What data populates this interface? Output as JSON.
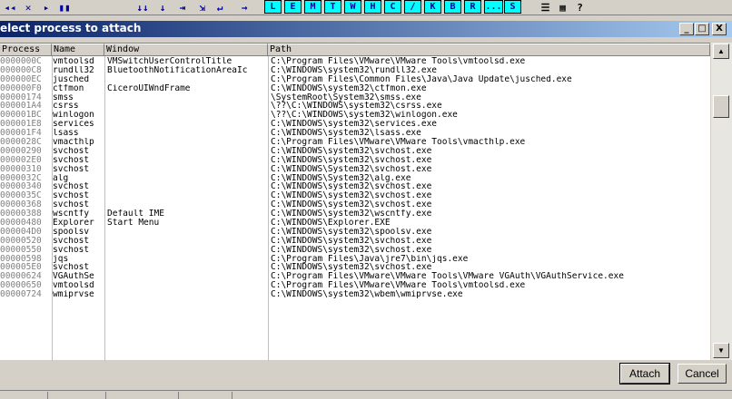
{
  "toolbar": {
    "icon_buttons": [
      {
        "glyph": "◂◂",
        "name": "rewind-icon"
      },
      {
        "glyph": "✕",
        "name": "close-icon"
      },
      {
        "glyph": "▸",
        "name": "play-icon"
      },
      {
        "glyph": "▮▮",
        "name": "pause-icon"
      },
      {
        "glyph": "↓↓",
        "name": "step-into-icon"
      },
      {
        "glyph": "↓",
        "name": "step-over-icon"
      },
      {
        "glyph": "⇥",
        "name": "trace-into-icon"
      },
      {
        "glyph": "⇲",
        "name": "trace-over-icon"
      },
      {
        "glyph": "↵",
        "name": "execute-till-return-icon"
      },
      {
        "glyph": "→",
        "name": "goto-icon"
      }
    ],
    "letter_buttons": [
      "L",
      "E",
      "M",
      "T",
      "W",
      "H",
      "C",
      "/",
      "K",
      "B",
      "R",
      "...",
      "S"
    ],
    "right_icons": [
      {
        "glyph": "☰",
        "name": "list-icon"
      },
      {
        "glyph": "▦",
        "name": "colors-icon"
      },
      {
        "glyph": "?",
        "name": "help-icon"
      }
    ]
  },
  "dialog": {
    "title": "elect process to attach",
    "controls": {
      "minimize": "_",
      "maximize": "□",
      "close": "X"
    }
  },
  "list": {
    "columns": [
      "Process",
      "Name",
      "Window",
      "Path"
    ],
    "rows": [
      [
        "0000000C",
        "vmtoolsd",
        "VMSwitchUserControlTitle",
        "C:\\Program Files\\VMware\\VMware Tools\\vmtoolsd.exe"
      ],
      [
        "000000C8",
        "rundll32",
        "BluetoothNotificationAreaIc",
        "C:\\WINDOWS\\system32\\rundll32.exe"
      ],
      [
        "000000EC",
        "jusched",
        "",
        "C:\\Program Files\\Common Files\\Java\\Java Update\\jusched.exe"
      ],
      [
        "000000F0",
        "ctfmon",
        "CiceroUIWndFrame",
        "C:\\WINDOWS\\system32\\ctfmon.exe"
      ],
      [
        "00000174",
        "smss",
        "",
        "\\SystemRoot\\System32\\smss.exe"
      ],
      [
        "000001A4",
        "csrss",
        "",
        "\\??\\C:\\WINDOWS\\system32\\csrss.exe"
      ],
      [
        "000001BC",
        "winlogon",
        "",
        "\\??\\C:\\WINDOWS\\system32\\winlogon.exe"
      ],
      [
        "000001E8",
        "services",
        "",
        "C:\\WINDOWS\\system32\\services.exe"
      ],
      [
        "000001F4",
        "lsass",
        "",
        "C:\\WINDOWS\\system32\\lsass.exe"
      ],
      [
        "0000028C",
        "vmacthlp",
        "",
        "C:\\Program Files\\VMware\\VMware Tools\\vmacthlp.exe"
      ],
      [
        "00000290",
        "svchost",
        "",
        "C:\\WINDOWS\\system32\\svchost.exe"
      ],
      [
        "000002E0",
        "svchost",
        "",
        "C:\\WINDOWS\\system32\\svchost.exe"
      ],
      [
        "00000310",
        "svchost",
        "",
        "C:\\WINDOWS\\System32\\svchost.exe"
      ],
      [
        "0000032C",
        "alg",
        "",
        "C:\\WINDOWS\\System32\\alg.exe"
      ],
      [
        "00000340",
        "svchost",
        "",
        "C:\\WINDOWS\\system32\\svchost.exe"
      ],
      [
        "0000035C",
        "svchost",
        "",
        "C:\\WINDOWS\\system32\\svchost.exe"
      ],
      [
        "00000368",
        "svchost",
        "",
        "C:\\WINDOWS\\system32\\svchost.exe"
      ],
      [
        "00000388",
        "wscntfy",
        "Default IME",
        "C:\\WINDOWS\\system32\\wscntfy.exe"
      ],
      [
        "00000480",
        "Explorer",
        "Start Menu",
        "C:\\WINDOWS\\Explorer.EXE"
      ],
      [
        "000004D0",
        "spoolsv",
        "",
        "C:\\WINDOWS\\system32\\spoolsv.exe"
      ],
      [
        "00000520",
        "svchost",
        "",
        "C:\\WINDOWS\\system32\\svchost.exe"
      ],
      [
        "00000550",
        "svchost",
        "",
        "C:\\WINDOWS\\system32\\svchost.exe"
      ],
      [
        "00000598",
        "jqs",
        "",
        "C:\\Program Files\\Java\\jre7\\bin\\jqs.exe"
      ],
      [
        "000005E0",
        "svchost",
        "",
        "C:\\WINDOWS\\system32\\svchost.exe"
      ],
      [
        "00000624",
        "VGAuthSe",
        "",
        "C:\\Program Files\\VMware\\VMware Tools\\VMware VGAuth\\VGAuthService.exe"
      ],
      [
        "00000650",
        "vmtoolsd",
        "",
        "C:\\Program Files\\VMware\\VMware Tools\\vmtoolsd.exe"
      ],
      [
        "00000724",
        "wmiprvse",
        "",
        "C:\\WINDOWS\\system32\\wbem\\wmiprvse.exe"
      ]
    ]
  },
  "buttons": {
    "attach": "Attach",
    "cancel": "Cancel"
  },
  "scrollbar": {
    "up": "▲",
    "down": "▼"
  },
  "colors": {
    "title_start": "#0a246a",
    "title_end": "#a6caf0",
    "face": "#d4d0c8",
    "letter_bg": "#00ffff"
  }
}
